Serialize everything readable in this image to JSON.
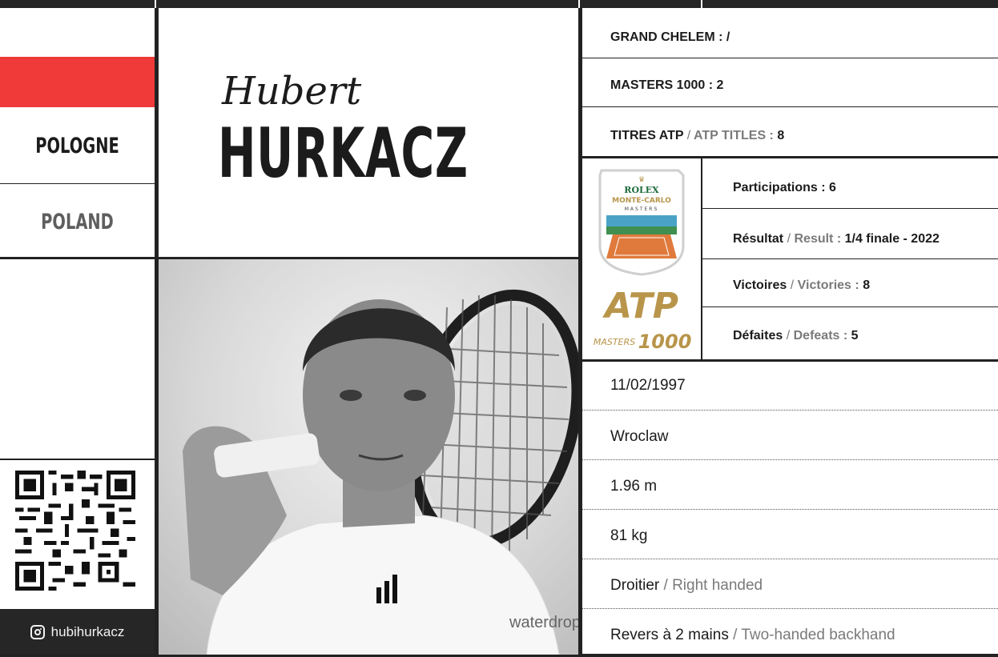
{
  "country": {
    "fr": "POLOGNE",
    "en": "POLAND"
  },
  "player": {
    "first_name": "Hubert",
    "last_name": "HURKACZ"
  },
  "instagram": {
    "handle": "hubihurkacz",
    "icon": "instagram-icon"
  },
  "colors": {
    "accent_red": "#ef3a39",
    "dark": "#262626",
    "muted": "#7a7a7a",
    "gold": "#b8954a",
    "rolex_green": "#1d6b3c"
  },
  "career": {
    "grand_slam": {
      "label": "GRAND CHELEM :",
      "value": "/"
    },
    "masters": {
      "label": "MASTERS 1000 :",
      "value": "2"
    },
    "titles": {
      "label_fr": "TITRES ATP",
      "sep": "/",
      "label_en": "ATP TITLES :",
      "value": "8"
    }
  },
  "tournament": {
    "logo": {
      "line1": "ROLEX",
      "line2": "MONTE-CARLO",
      "line3": "MASTERS"
    },
    "atp_logo": {
      "word": "ATP",
      "sub": "MASTERS",
      "num": "1000"
    },
    "participations": {
      "label": "Participations :",
      "value": "6"
    },
    "result": {
      "label_fr": "Résultat",
      "sep": "/",
      "label_en": "Result :",
      "value": "1/4 finale - 2022"
    },
    "victories": {
      "label_fr": "Victoires",
      "sep": "/",
      "label_en": "Victories :",
      "value": "8"
    },
    "defeats": {
      "label_fr": "Défaites",
      "sep": "/",
      "label_en": "Defeats :",
      "value": "5"
    }
  },
  "bio": {
    "birthdate": "11/02/1997",
    "birthplace": "Wroclaw",
    "height": "1.96 m",
    "weight": "81 kg",
    "hand": {
      "fr": "Droitier",
      "sep": "/",
      "en": "Right handed"
    },
    "backhand": {
      "fr": "Revers à 2 mains",
      "sep": "/",
      "en": "Two-handed backhand"
    }
  },
  "photo": {
    "shirt_brand": "waterdrop"
  }
}
